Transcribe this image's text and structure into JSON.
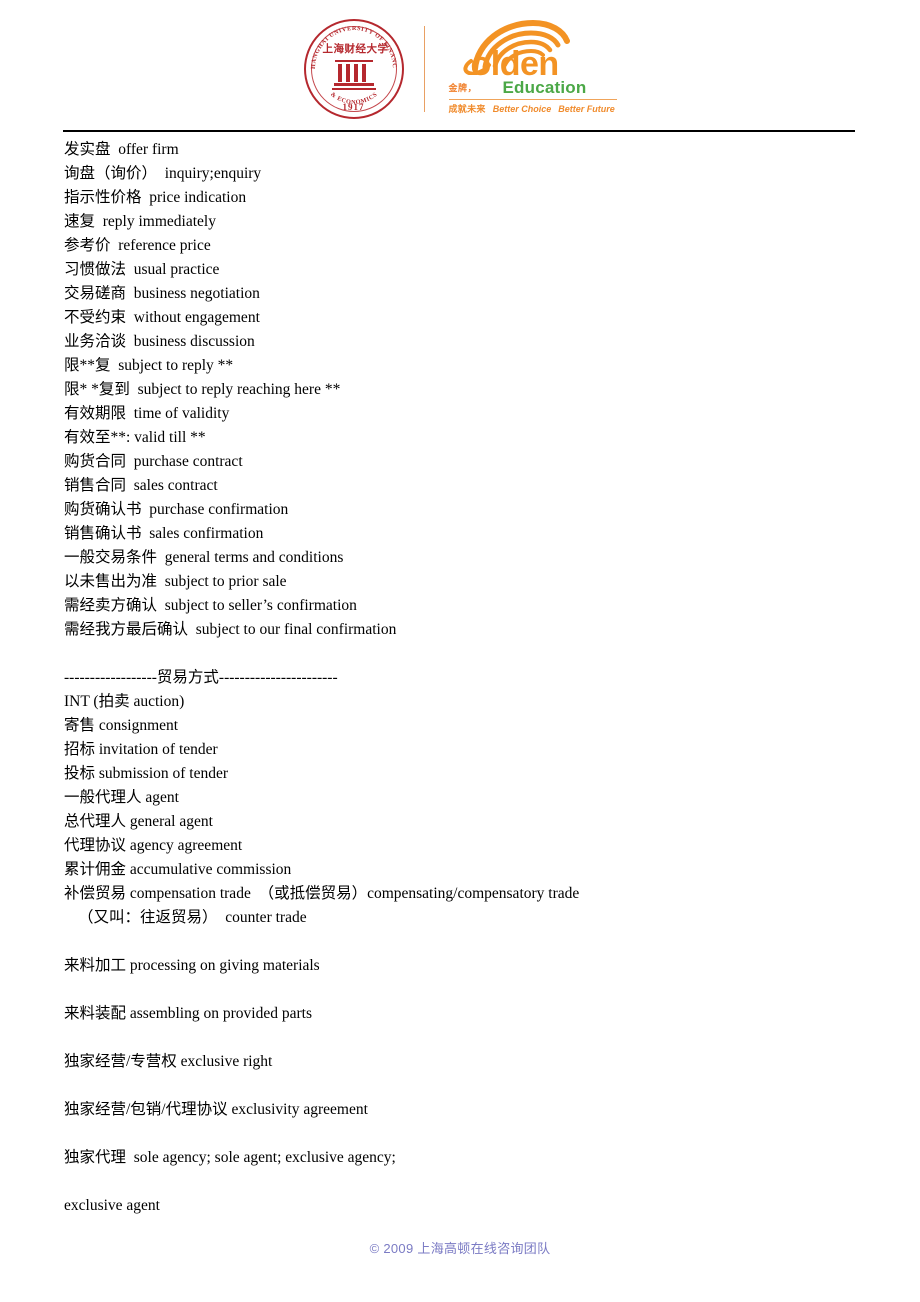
{
  "header": {
    "university_seal": {
      "arc_text_top": "SHANGHAI UNIVERSITY OF FINANCE",
      "arc_text_bottom": "& ECONOMICS",
      "center_chinese": "上海财经大学",
      "year": "1917"
    },
    "golden_logo": {
      "brand": "olden",
      "brand_initial": "G",
      "subtitle": "Education",
      "chinese_small": "金牌，",
      "chinese_tagline": "成就未来",
      "tagline_en_1": "Better Choice",
      "tagline_en_2": "Better Future"
    },
    "colors": {
      "seal_red": "#b5282e",
      "golden_orange": "#f39324",
      "education_green": "#4ba847",
      "divider_orange": "#e9a063"
    }
  },
  "body_lines": [
    {
      "text": "发实盘  offer firm"
    },
    {
      "text": "询盘（询价）  inquiry;enquiry"
    },
    {
      "text": "指示性价格  price indication"
    },
    {
      "text": "速复  reply immediately"
    },
    {
      "text": "参考价  reference price"
    },
    {
      "text": "习惯做法  usual practice"
    },
    {
      "text": "交易磋商  business negotiation"
    },
    {
      "text": "不受约束  without engagement"
    },
    {
      "text": "业务洽谈  business discussion"
    },
    {
      "text": "限**复  subject to reply **"
    },
    {
      "text": "限* *复到  subject to reply reaching here **"
    },
    {
      "text": "有效期限  time of validity"
    },
    {
      "text": "有效至**: valid till **"
    },
    {
      "text": "购货合同  purchase contract"
    },
    {
      "text": "销售合同  sales contract"
    },
    {
      "text": "购货确认书  purchase confirmation"
    },
    {
      "text": "销售确认书  sales confirmation"
    },
    {
      "text": "一般交易条件  general terms and conditions"
    },
    {
      "text": "以未售出为准  subject to prior sale"
    },
    {
      "text": "需经卖方确认  subject to seller’s confirmation"
    },
    {
      "text": "需经我方最后确认  subject to our final confirmation"
    },
    {
      "text": "",
      "blank": true
    },
    {
      "text": "------------------贸易方式-----------------------"
    },
    {
      "text": "INT (拍卖 auction)"
    },
    {
      "text": "寄售 consignment"
    },
    {
      "text": "招标 invitation of tender"
    },
    {
      "text": "投标 submission of tender"
    },
    {
      "text": "一般代理人 agent"
    },
    {
      "text": "总代理人 general agent"
    },
    {
      "text": "代理协议 agency agreement"
    },
    {
      "text": "累计佣金 accumulative commission"
    },
    {
      "text": "补偿贸易 compensation trade  （或抵偿贸易）compensating/compensatory trade"
    },
    {
      "text": "（又叫：往返贸易）  counter trade",
      "indent": true
    },
    {
      "text": "",
      "blank": true
    },
    {
      "text": "来料加工 processing on giving materials"
    },
    {
      "text": "",
      "blank": true
    },
    {
      "text": "来料装配 assembling on provided parts"
    },
    {
      "text": "",
      "blank": true
    },
    {
      "text": "独家经营/专营权 exclusive right"
    },
    {
      "text": "",
      "blank": true
    },
    {
      "text": "独家经营/包销/代理协议 exclusivity agreement"
    },
    {
      "text": "",
      "blank": true
    },
    {
      "text": "独家代理  sole agency; sole agent; exclusive agency;"
    },
    {
      "text": "",
      "blank": true
    },
    {
      "text": "exclusive agent"
    }
  ],
  "footer": {
    "copyright": "© 2009 上海高顿在线咨询团队",
    "color": "#7b7bc4"
  }
}
